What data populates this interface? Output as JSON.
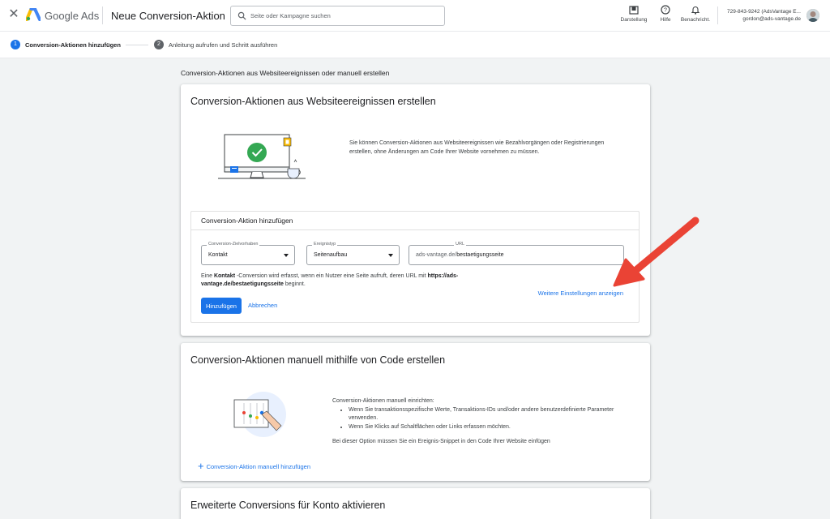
{
  "header": {
    "close_icon": "close-icon",
    "brand": "Google Ads",
    "title": "Neue Conversion-Aktion",
    "search_placeholder": "Seite oder Kampagne suchen",
    "appearance_label": "Darstellung",
    "help_label": "Hilfe",
    "notifications_label": "Benachricht.",
    "account_id": "729-843-9242 (AdsVantage E...",
    "account_email": "gordon@ads-vantage.de"
  },
  "stepper": {
    "steps": [
      {
        "num": "1",
        "label": "Conversion-Aktionen hinzufügen",
        "active": true
      },
      {
        "num": "2",
        "label": "Anleitung aufrufen und Schritt ausführen",
        "active": false
      }
    ]
  },
  "main": {
    "heading": "Conversion-Aktionen aus Websiteereignissen oder manuell erstellen"
  },
  "card_web": {
    "title": "Conversion-Aktionen aus Websiteereignissen erstellen",
    "description": "Sie können Conversion-Aktionen aus Websiteereignissen wie Bezahlvorgängen oder Registrierungen erstellen, ohne Änderungen am Code Ihrer Website vornehmen zu müssen.",
    "form": {
      "title": "Conversion-Aktion hinzufügen",
      "goal_label": "Conversion-Zielvorhaben",
      "goal_value": "Kontakt",
      "event_label": "Ereignistyp",
      "event_value": "Seitenaufbau",
      "url_label": "URL",
      "url_prefix": "ads-vantage.de/",
      "url_value": "bestaetigungsseite",
      "info_1": "Eine ",
      "info_goal": "Kontakt",
      "info_2": " -Conversion wird erfasst, wenn ein Nutzer eine Seite aufruft, deren URL mit ",
      "info_url": "https://ads-vantage.de/bestaetigungsseite",
      "info_3": " beginnt.",
      "more_settings": "Weitere Einstellungen anzeigen",
      "add_button": "Hinzufügen",
      "cancel_button": "Abbrechen"
    }
  },
  "card_manual": {
    "title": "Conversion-Aktionen manuell mithilfe von Code erstellen",
    "intro": "Conversion-Aktionen manuell einrichten:",
    "bullets": [
      "Wenn Sie transaktionsspezifische Werte, Transaktions-IDs und/oder andere benutzerdefinierte Parameter verwenden.",
      "Wenn Sie Klicks auf Schaltflächen oder Links erfassen möchten."
    ],
    "note": "Bei dieser Option müssen Sie ein Ereignis-Snippet in den Code Ihrer Website einfügen",
    "add_manual": "Conversion-Aktion manuell hinzufügen"
  },
  "card_enhanced": {
    "title": "Erweiterte Conversions für Konto aktivieren"
  },
  "colors": {
    "primary": "#1a73e8",
    "annotation_arrow": "#ea4335",
    "background": "#f1f3f4"
  }
}
